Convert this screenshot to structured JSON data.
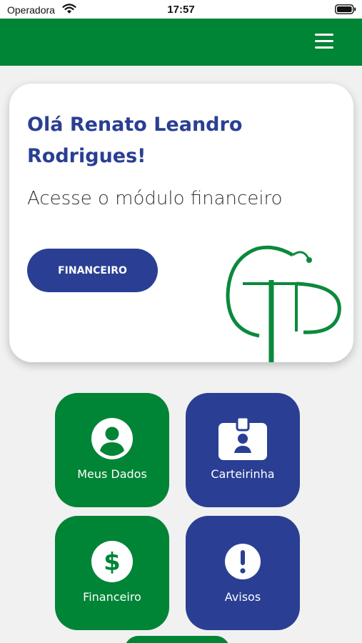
{
  "status_bar": {
    "carrier": "Operadora",
    "time": "17:57"
  },
  "header": {
    "menu_icon": "hamburger-menu-icon"
  },
  "welcome_card": {
    "greeting": "Olá Renato Leandro Rodrigues!",
    "subtitle": "Acesse o módulo financeiro",
    "button_label": "FINANCEIRO",
    "logo_icon": "gp-logo"
  },
  "tiles": [
    {
      "label": "Meus Dados",
      "icon": "user-circle-icon",
      "color": "#008436"
    },
    {
      "label": "Carteirinha",
      "icon": "id-badge-icon",
      "color": "#2a3f93"
    },
    {
      "label": "Financeiro",
      "icon": "dollar-circle-icon",
      "color": "#008436"
    },
    {
      "label": "Avisos",
      "icon": "exclamation-circle-icon",
      "color": "#2a3f93"
    }
  ],
  "colors": {
    "brand_green": "#008436",
    "brand_blue": "#2a3f93",
    "background": "#f1f1f1"
  }
}
